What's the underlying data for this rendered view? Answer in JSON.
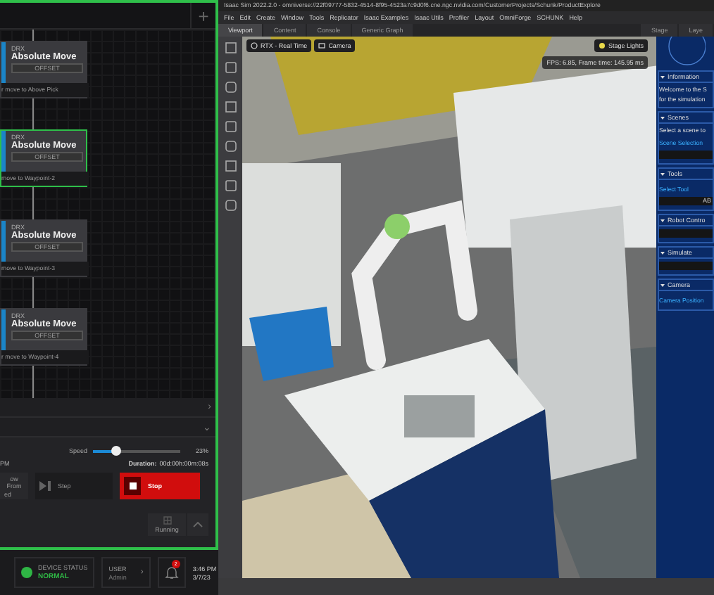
{
  "flow_editor": {
    "add_button": "+",
    "nodes": [
      {
        "category": "DRX",
        "title": "Absolute Move",
        "button": "OFFSET",
        "caption": "r move to Above Pick",
        "selected": false
      },
      {
        "category": "DRX",
        "title": "Absolute Move",
        "button": "OFFSET",
        "caption": "move to Waypoint-2",
        "selected": true
      },
      {
        "category": "DRX",
        "title": "Absolute Move",
        "button": "OFFSET",
        "caption": "move to Waypoint-3",
        "selected": false
      },
      {
        "category": "DRX",
        "title": "Absolute Move",
        "button": "OFFSET",
        "caption": "r move to Waypoint-4",
        "selected": false
      }
    ]
  },
  "panel_rows": [
    {
      "chevron": "›"
    },
    {
      "chevron": "⌄"
    }
  ],
  "run_panel": {
    "speed_label": "Speed",
    "speed": {
      "level": 0.26
    },
    "speed_reading": "23%",
    "start_time": "PM",
    "duration_label": "Duration:",
    "duration": "00d:00h:00m:08s",
    "buttons": [
      {
        "kind": "run_from",
        "lines": [
          "ow From",
          "ed"
        ],
        "disabled": true
      },
      {
        "kind": "step",
        "label": "Step",
        "disabled": true
      },
      {
        "kind": "stop",
        "label": "Stop",
        "disabled": false
      }
    ],
    "running_label": "Running"
  },
  "status_bar": {
    "device_status_label": "DEVICE STATUS",
    "device_status": "NORMAL",
    "healthy": true,
    "user_label": "USER",
    "user": "Admin",
    "user_chevron": "›",
    "notifications": "2",
    "time": "3:46 PM",
    "date": "3/7/23"
  },
  "sim_window": {
    "title": "Isaac Sim 2022.2.0 - omniverse://22f09777-5832-4514-8f95-4523a7c9d0f6.cne.ngc.nvidia.com/CustomerProjects/Schunk/ProductExplore",
    "menu": [
      "File",
      "Edit",
      "Create",
      "Window",
      "Tools",
      "Replicator",
      "Isaac Examples",
      "Isaac Utils",
      "Profiler",
      "Layout",
      "OmniForge",
      "SCHUNK",
      "Help"
    ],
    "tabs": [
      {
        "label": "Viewport",
        "selected": true
      },
      {
        "label": "Content",
        "selected": false
      },
      {
        "label": "Console",
        "selected": false
      },
      {
        "label": "Generic Graph",
        "selected": false
      }
    ],
    "side_tabs": [
      {
        "label": "Stage",
        "selected": false
      },
      {
        "label": "Laye",
        "selected": false
      }
    ],
    "viewport": {
      "kind": "picture",
      "render_mode": "RTX - Real Time",
      "camera": "Camera",
      "lights": "Stage Lights",
      "fps": "FPS: 6.85, Frame time: 145.95 ms"
    },
    "panel_sections": [
      {
        "title": "Information",
        "items": [
          {
            "kind": "text",
            "text": "Welcome to the S"
          },
          {
            "kind": "text",
            "text": "for the simulation"
          }
        ]
      },
      {
        "title": "Scenes",
        "items": [
          {
            "kind": "text",
            "text": "Select a scene to"
          },
          {
            "kind": "label",
            "text": "Scene Selection"
          },
          {
            "kind": "field"
          }
        ]
      },
      {
        "title": "Tools",
        "items": [
          {
            "kind": "label",
            "text": "Select Tool"
          },
          {
            "kind": "field",
            "text": "AB"
          }
        ]
      },
      {
        "title": "Robot Contro",
        "items": [
          {
            "kind": "field"
          }
        ]
      },
      {
        "title": "Simulate",
        "items": [
          {
            "kind": "field"
          }
        ]
      },
      {
        "title": "Camera",
        "items": [
          {
            "kind": "label",
            "text": "Camera Position"
          }
        ]
      }
    ]
  }
}
